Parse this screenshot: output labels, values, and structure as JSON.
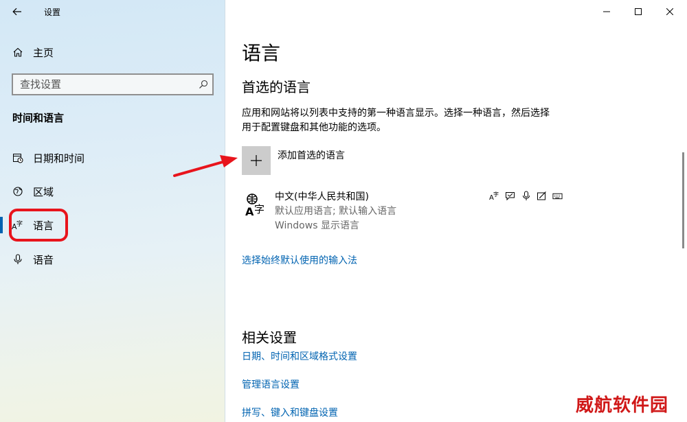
{
  "window": {
    "app_title": "设置",
    "controls": [
      "minimize",
      "maximize",
      "close"
    ]
  },
  "sidebar": {
    "home_label": "主页",
    "search_placeholder": "查找设置",
    "section_title": "时间和语言",
    "items": [
      {
        "label": "日期和时间",
        "icon": "calendar-clock-icon"
      },
      {
        "label": "区域",
        "icon": "globe-icon"
      },
      {
        "label": "语言",
        "icon": "language-icon",
        "selected": true
      },
      {
        "label": "语音",
        "icon": "microphone-icon"
      }
    ]
  },
  "main": {
    "page_title": "语言",
    "preferred_heading": "首选的语言",
    "description": "应用和网站将以列表中支持的第一种语言显示。选择一种语言，然后选择用于配置键盘和其他功能的选项。",
    "add_label": "添加首选的语言",
    "language": {
      "name": "中文(中华人民共和国)",
      "sub1": "默认应用语言; 默认输入语言",
      "sub2": "Windows 显示语言",
      "feature_icons": [
        "language-pack-icon",
        "speech-bubble-icon",
        "microphone-icon",
        "handwriting-icon",
        "keyboard-icon"
      ]
    },
    "input_method_link": "选择始终默认使用的输入法",
    "related_heading": "相关设置",
    "related_links": [
      "日期、时间和区域格式设置",
      "管理语言设置",
      "拼写、键入和键盘设置"
    ]
  },
  "watermark": "威航软件园",
  "colors": {
    "accent": "#0063b1",
    "highlight_red": "#e8141c",
    "add_button_bg": "#cccccc"
  }
}
